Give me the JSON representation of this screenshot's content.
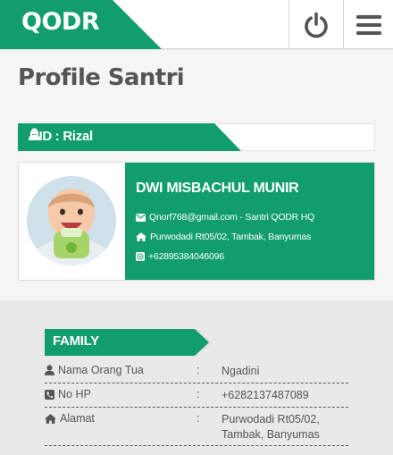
{
  "header": {
    "brand": "QODR",
    "brand_color": "#129e6c",
    "power_icon": "power-icon",
    "menu_icon": "hamburger-menu-icon"
  },
  "page": {
    "title": "Profile Santri"
  },
  "uid": {
    "icon": "user-icon",
    "label": "UID : Rizal"
  },
  "profile": {
    "name": "DWI MISBACHUL MUNIR",
    "email_line": "Qnorf768@gmail.com - Santri QODR HQ",
    "address_line": "Purwodadi Rt05/02, Tambak, Banyumas",
    "phone_line": "+62895384046096",
    "icons": [
      "envelope-icon",
      "home-icon",
      "whatsapp-icon"
    ]
  },
  "family": {
    "title": "FAMILY",
    "rows": [
      {
        "icon": "user-icon",
        "label": "Nama Orang Tua",
        "sep": ":",
        "value": "Ngadini"
      },
      {
        "icon": "phone-icon",
        "label": "No HP",
        "sep": ":",
        "value": "+6282137487089"
      },
      {
        "icon": "home-icon",
        "label": "Alamat",
        "sep": ":",
        "value": "Purwodadi Rt05/02, Tambak, Banyumas"
      }
    ]
  }
}
